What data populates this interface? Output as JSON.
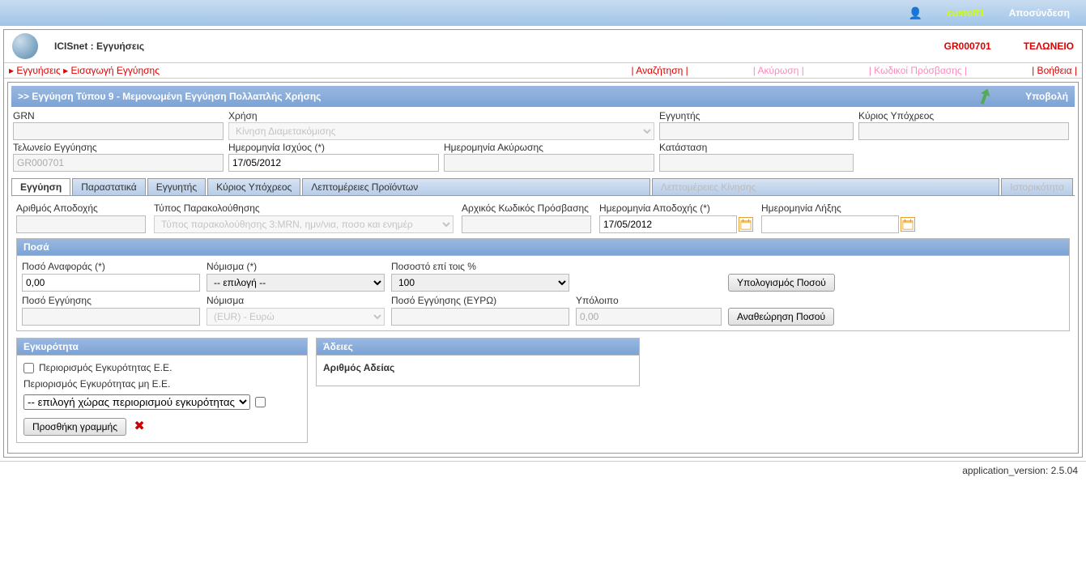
{
  "topbar": {
    "username": "custoff1",
    "logout": "Αποσύνδεση"
  },
  "header": {
    "app_title": "ICISnet : Εγγυήσεις",
    "code": "GR000701",
    "office": "ΤΕΛΩΝΕΙΟ"
  },
  "crumbs": {
    "breadcrumb": "▸ Εγγυήσεις ▸ Εισαγωγή Εγγύησης",
    "search": "| Αναζήτηση |",
    "cancel": "| Ακύρωση |",
    "access_codes": "| Κωδικοί Πρόσβασης |",
    "help": "| Βοήθεια |"
  },
  "section": {
    "title": ">> Εγγύηση Τύπου 9 - Μεμονωμένη Εγγύηση Πολλαπλής Χρήσης",
    "submit": "Υποβολή"
  },
  "main_form": {
    "grn_label": "GRN",
    "grn_value": "",
    "usage_label": "Χρήση",
    "usage_value": "Κίνηση Διαμετακόμισης",
    "guarantor_label": "Εγγυητής",
    "guarantor_value": "",
    "principal_label": "Κύριος Υπόχρεος",
    "principal_value": "",
    "office_label": "Τελωνείο Εγγύησης",
    "office_value": "GR000701",
    "eff_date_label": "Ημερομηνία Ισχύος (*)",
    "eff_date_value": "17/05/2012",
    "cancel_date_label": "Ημερομηνία Ακύρωσης",
    "cancel_date_value": "",
    "state_label": "Κατάσταση",
    "state_value": ""
  },
  "tabs": {
    "t0": "Εγγύηση",
    "t1": "Παραστατικά",
    "t2": "Εγγυητής",
    "t3": "Κύριος Υπόχρεος",
    "t4": "Λεπτομέρειες Προϊόντων",
    "t5": "Λεπτομέρειες Κίνησης",
    "t6": "Ιστορικότητα"
  },
  "g": {
    "accept_no_label": "Αριθμός Αποδοχής",
    "accept_no_value": "",
    "monitor_label": "Τύπος Παρακολούθησης",
    "monitor_placeholder": "Τύπος παρακολούθησης 3:MRN, ημν/νια, ποσο και ενημέρ",
    "init_code_label": "Αρχικός Κωδικός Πρόσβασης",
    "init_code_value": "",
    "accept_date_label": "Ημερομηνία Αποδοχής (*)",
    "accept_date_value": "17/05/2012",
    "expiry_label": "Ημερομηνία Λήξης",
    "expiry_value": ""
  },
  "amounts": {
    "panel_title": "Ποσά",
    "ref_amount_label": "Ποσό Αναφοράς (*)",
    "ref_amount_value": "0,00",
    "currency_label": "Νόμισμα (*)",
    "currency_value": "-- επιλογή --",
    "percent_label": "Ποσοστό επί τοις %",
    "percent_value": "100",
    "calc_btn": "Υπολογισμός Ποσού",
    "guar_amount_label": "Ποσό Εγγύησης",
    "guar_amount_value": "",
    "currency2_label": "Νόμισμα",
    "currency2_value": "(EUR) - Ευρώ",
    "guar_eur_label": "Ποσό Εγγύησης (ΕΥΡΩ)",
    "guar_eur_value": "",
    "balance_label": "Υπόλοιπο",
    "balance_value": "0,00",
    "review_btn": "Αναθεώρηση Ποσού"
  },
  "validity": {
    "title": "Εγκυρότητα",
    "restrict_eu": "Περιορισμός Εγκυρότητας E.E.",
    "restrict_non_eu": "Περιορισμός Εγκυρότητας μη E.E.",
    "country_select": "-- επιλογή χώρας περιορισμού εγκυρότητας --",
    "add_line": "Προσθήκη γραμμής"
  },
  "licenses": {
    "title": "Άδειες",
    "license_no": "Αριθμός Αδείας"
  },
  "footer": {
    "version": "application_version: 2.5.04"
  }
}
